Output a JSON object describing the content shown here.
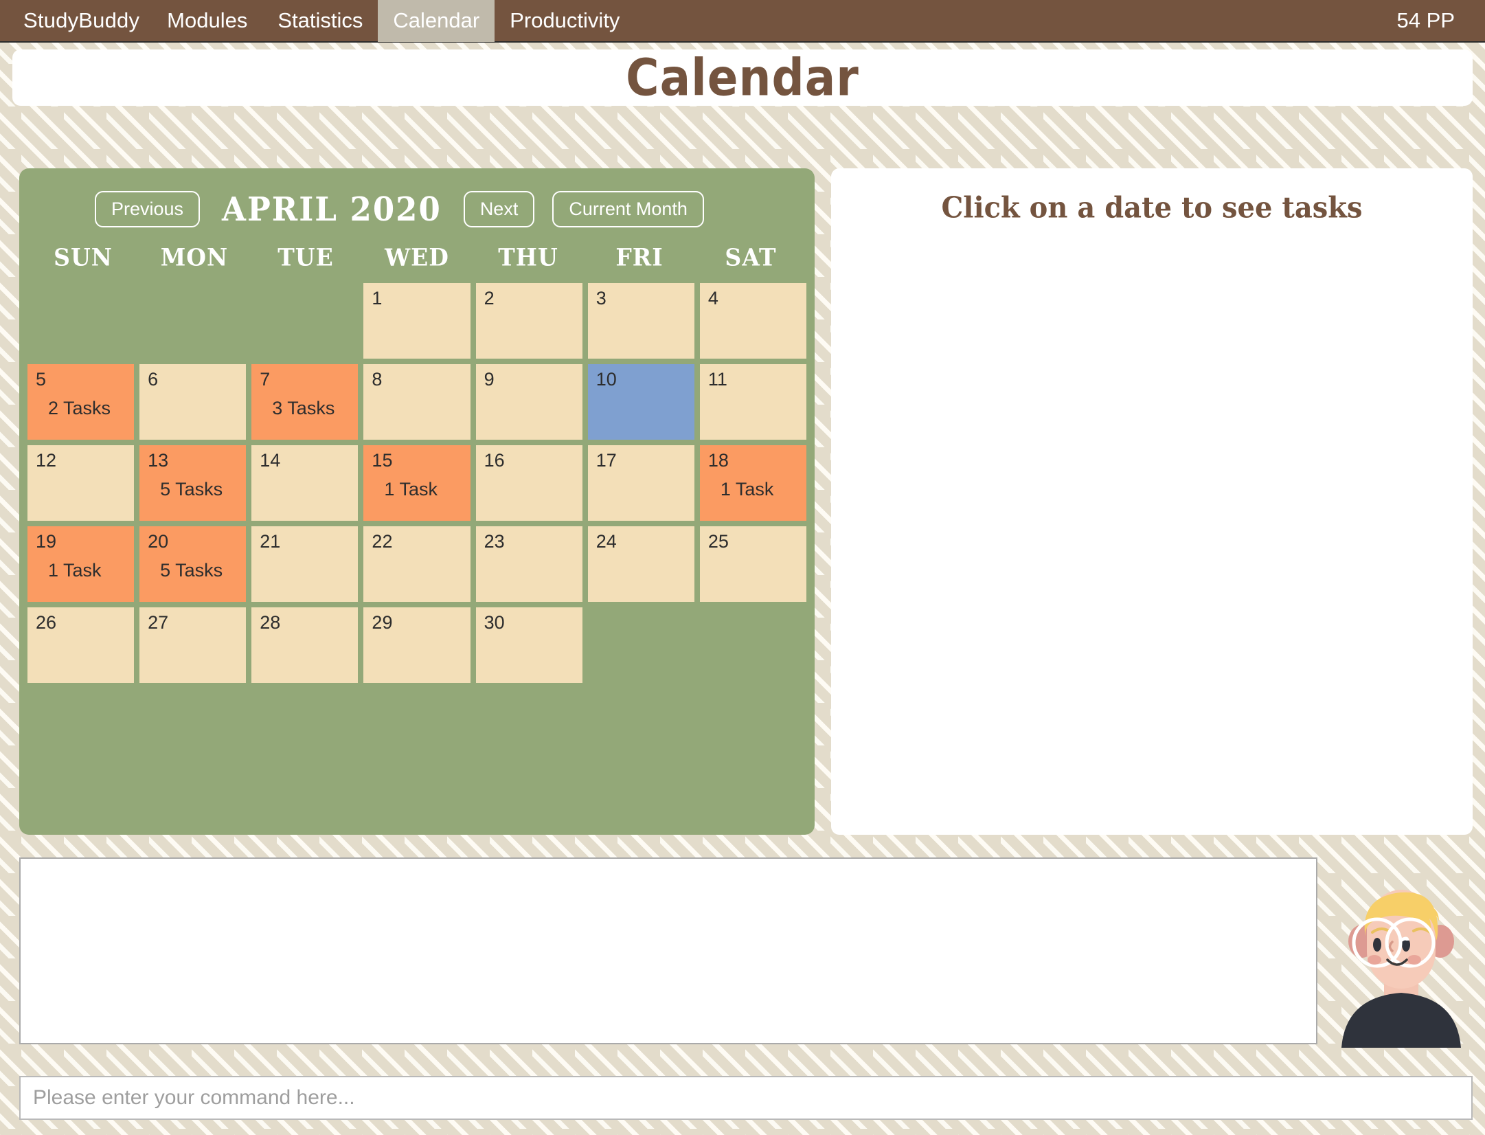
{
  "navbar": {
    "brand": "StudyBuddy",
    "items": [
      {
        "label": "Modules",
        "active": false
      },
      {
        "label": "Statistics",
        "active": false
      },
      {
        "label": "Calendar",
        "active": true
      },
      {
        "label": "Productivity",
        "active": false
      }
    ],
    "points": "54 PP",
    "background_color": "#74543f",
    "active_tab_color": "#c0baab"
  },
  "header": {
    "page_title": "Calendar",
    "title_color": "#74543f"
  },
  "calendar": {
    "panel_color": "#93a878",
    "previous_label": "Previous",
    "next_label": "Next",
    "current_month_label": "Current Month",
    "month_title": "APRIL 2020",
    "weekdays": [
      "SUN",
      "MON",
      "TUE",
      "WED",
      "THU",
      "FRI",
      "SAT"
    ],
    "day_colors": {
      "default": "#f3dfb8",
      "has_tasks": "#fb9b62",
      "selected": "#7fa0d0"
    },
    "leading_blanks": 3,
    "days": [
      {
        "day": "1",
        "tasks": "",
        "state": "default"
      },
      {
        "day": "2",
        "tasks": "",
        "state": "default"
      },
      {
        "day": "3",
        "tasks": "",
        "state": "default"
      },
      {
        "day": "4",
        "tasks": "",
        "state": "default"
      },
      {
        "day": "5",
        "tasks": "2 Tasks",
        "state": "has-tasks"
      },
      {
        "day": "6",
        "tasks": "",
        "state": "default"
      },
      {
        "day": "7",
        "tasks": "3 Tasks",
        "state": "has-tasks"
      },
      {
        "day": "8",
        "tasks": "",
        "state": "default"
      },
      {
        "day": "9",
        "tasks": "",
        "state": "default"
      },
      {
        "day": "10",
        "tasks": "",
        "state": "selected"
      },
      {
        "day": "11",
        "tasks": "",
        "state": "default"
      },
      {
        "day": "12",
        "tasks": "",
        "state": "default"
      },
      {
        "day": "13",
        "tasks": "5 Tasks",
        "state": "has-tasks"
      },
      {
        "day": "14",
        "tasks": "",
        "state": "default"
      },
      {
        "day": "15",
        "tasks": "1 Task",
        "state": "has-tasks"
      },
      {
        "day": "16",
        "tasks": "",
        "state": "default"
      },
      {
        "day": "17",
        "tasks": "",
        "state": "default"
      },
      {
        "day": "18",
        "tasks": "1 Task",
        "state": "has-tasks"
      },
      {
        "day": "19",
        "tasks": "1 Task",
        "state": "has-tasks"
      },
      {
        "day": "20",
        "tasks": "5 Tasks",
        "state": "has-tasks"
      },
      {
        "day": "21",
        "tasks": "",
        "state": "default"
      },
      {
        "day": "22",
        "tasks": "",
        "state": "default"
      },
      {
        "day": "23",
        "tasks": "",
        "state": "default"
      },
      {
        "day": "24",
        "tasks": "",
        "state": "default"
      },
      {
        "day": "25",
        "tasks": "",
        "state": "default"
      },
      {
        "day": "26",
        "tasks": "",
        "state": "default"
      },
      {
        "day": "27",
        "tasks": "",
        "state": "default"
      },
      {
        "day": "28",
        "tasks": "",
        "state": "default"
      },
      {
        "day": "29",
        "tasks": "",
        "state": "default"
      },
      {
        "day": "30",
        "tasks": "",
        "state": "default"
      }
    ]
  },
  "task_panel": {
    "heading": "Click on a date to see tasks"
  },
  "output": {
    "text": ""
  },
  "avatar": {
    "icon": "student-avatar",
    "hair_color": "#f7cf68",
    "skin_color": "#f3c4b2",
    "shirt_color": "#2f333c",
    "glasses_color": "#ffffff"
  },
  "command": {
    "value": "",
    "placeholder": "Please enter your command here..."
  }
}
